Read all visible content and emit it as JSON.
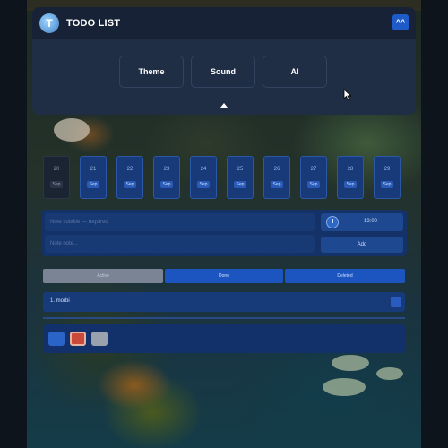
{
  "app": {
    "title": "TODO LIST",
    "logo_letter": "T",
    "collapse_label": "^^"
  },
  "menu": {
    "items": [
      {
        "label": "Theme"
      },
      {
        "label": "Sound"
      },
      {
        "label": "AI"
      }
    ]
  },
  "days": [
    {
      "num": "20",
      "mon": "Sep",
      "past": true
    },
    {
      "num": "21",
      "mon": "Sep",
      "past": false
    },
    {
      "num": "22",
      "mon": "Sep",
      "past": false
    },
    {
      "num": "23",
      "mon": "Sep",
      "past": false
    },
    {
      "num": "24",
      "mon": "Sep",
      "past": false
    },
    {
      "num": "25",
      "mon": "Sep",
      "past": false
    },
    {
      "num": "26",
      "mon": "Sep",
      "past": false
    },
    {
      "num": "27",
      "mon": "Sep",
      "past": false
    },
    {
      "num": "28",
      "mon": "Sep",
      "past": false
    },
    {
      "num": "29",
      "mon": "Sep",
      "past": false
    }
  ],
  "form": {
    "title_placeholder": "Note subtitle — required",
    "note_placeholder": "Note note...",
    "time_value": "13:00",
    "add_label": "Add"
  },
  "tabs": [
    {
      "label": "Active",
      "active": true
    },
    {
      "label": "Done",
      "active": false
    },
    {
      "label": "Deleted",
      "active": false
    }
  ],
  "tasks": [
    {
      "label": "1. morbi"
    }
  ],
  "colors": {
    "accent": "#1e5ac8",
    "panel": "#1f2d45",
    "footer_icon_1": "#2a64c8",
    "footer_icon_2": "#c84a3a",
    "footer_icon_3": "#9aa2ae"
  }
}
